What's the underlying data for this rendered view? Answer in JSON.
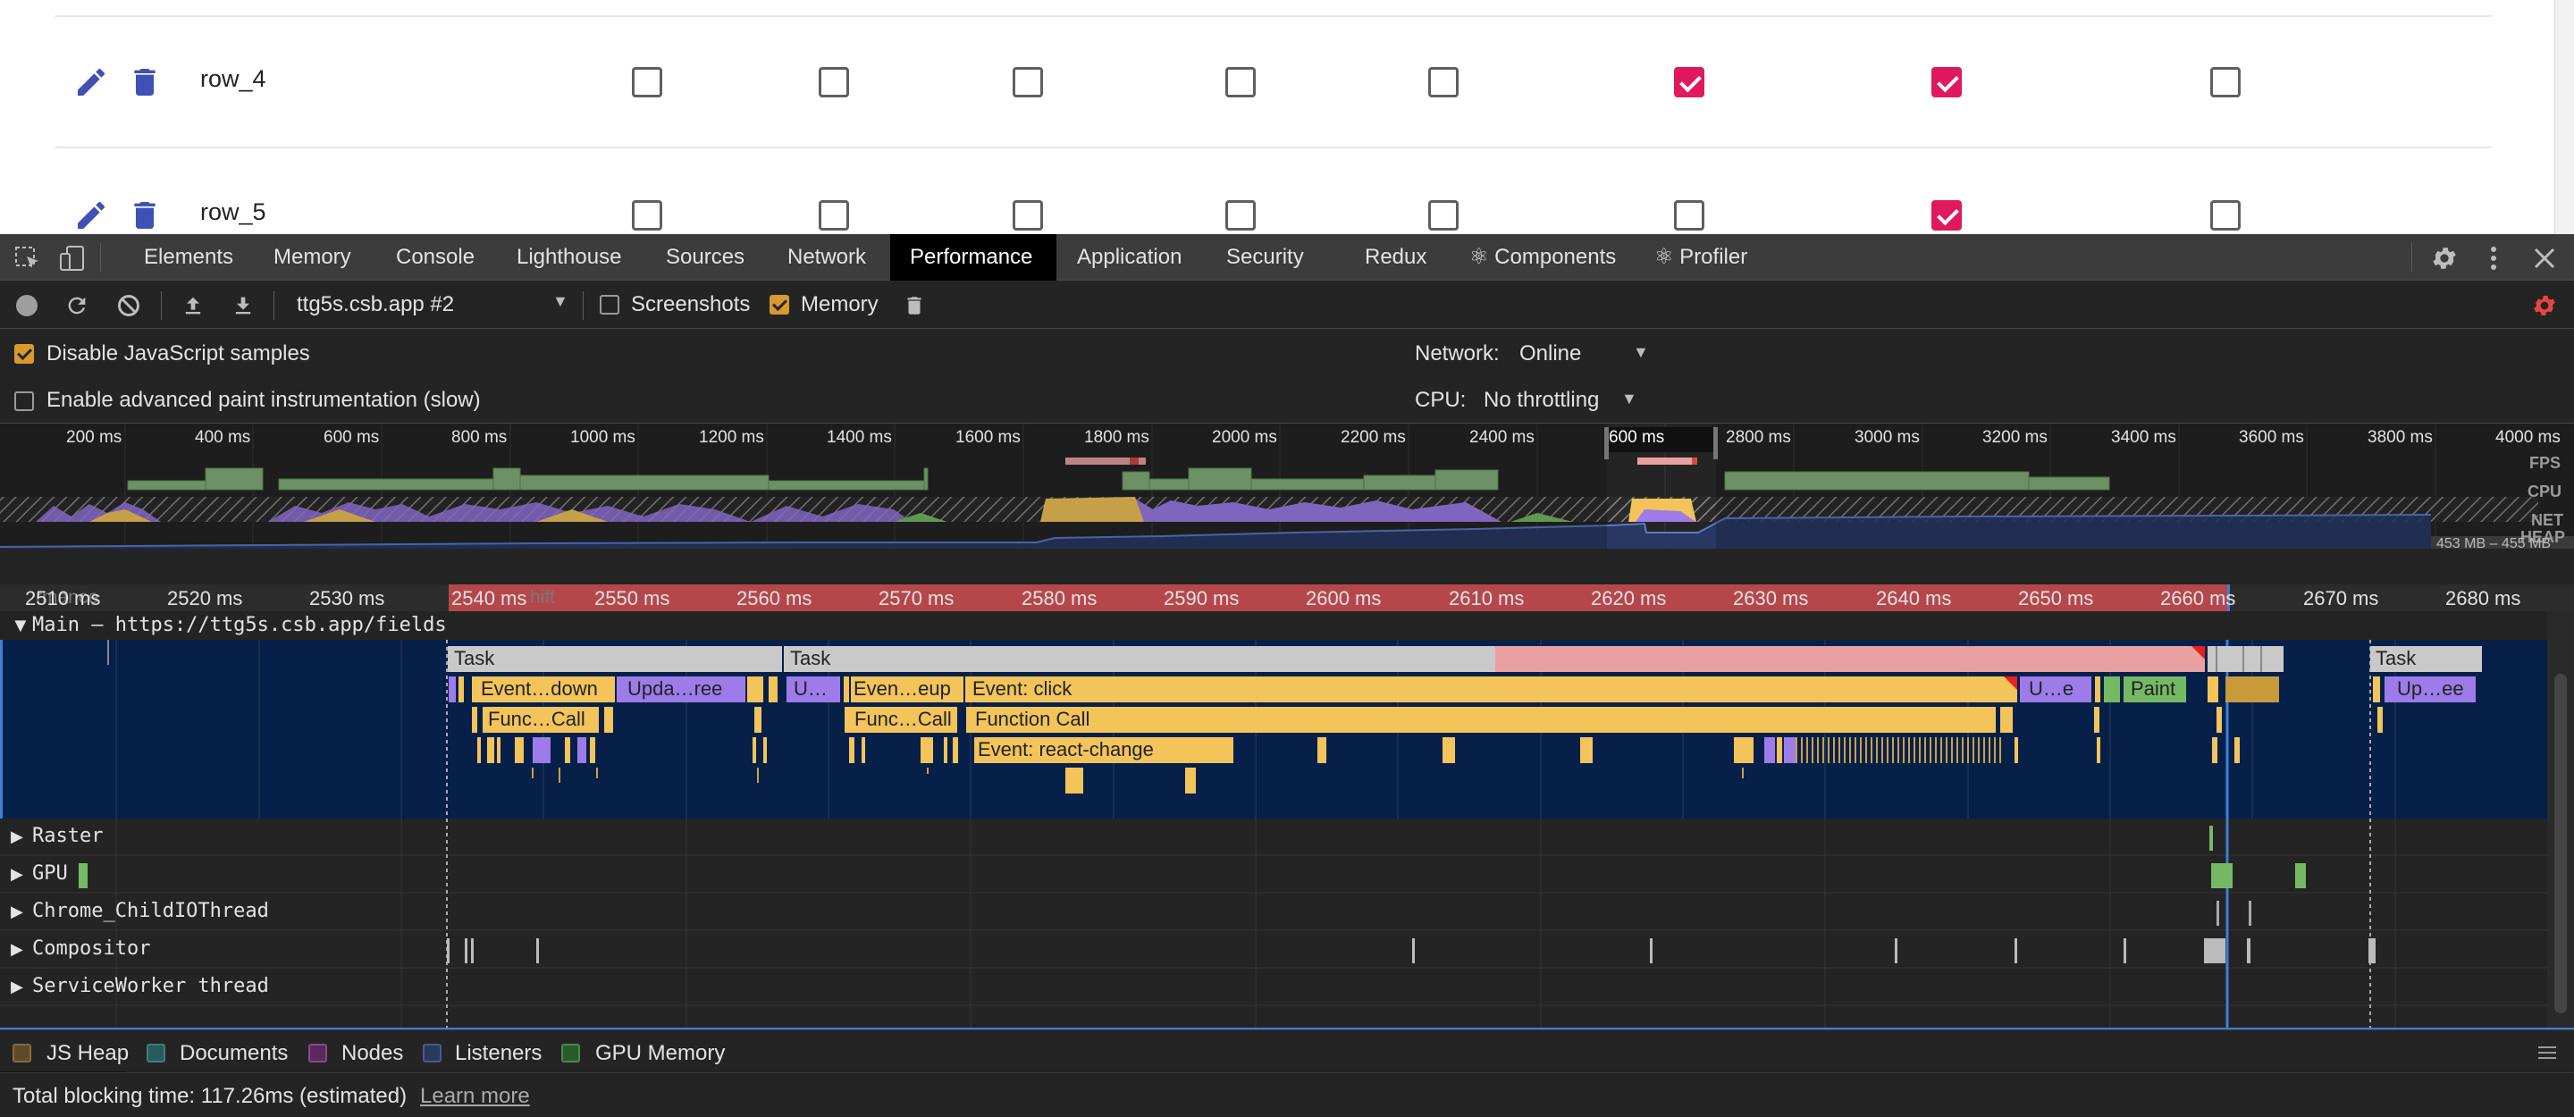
{
  "app": {
    "rows": [
      {
        "label": "row_4",
        "checks": [
          false,
          false,
          false,
          false,
          false,
          true,
          true,
          false
        ]
      },
      {
        "label": "row_5",
        "checks": [
          false,
          false,
          false,
          false,
          false,
          false,
          true,
          false
        ]
      }
    ]
  },
  "devtools": {
    "tabs": [
      "Elements",
      "Memory",
      "Console",
      "Lighthouse",
      "Sources",
      "Network",
      "Performance",
      "Application",
      "Security",
      "Redux",
      "⚛ Components",
      "⚛ Profiler"
    ],
    "active_tab": "Performance",
    "toolbar": {
      "profile_select": "ttg5s.csb.app #2",
      "screenshots_label": "Screenshots",
      "screenshots_checked": false,
      "memory_label": "Memory",
      "memory_checked": true
    },
    "settings": {
      "disable_js_samples": "Disable JavaScript samples",
      "disable_js_samples_checked": true,
      "advanced_paint": "Enable advanced paint instrumentation (slow)",
      "advanced_paint_checked": false,
      "network_label": "Network:",
      "network_value": "Online",
      "cpu_label": "CPU:",
      "cpu_value": "No throttling"
    },
    "overview": {
      "ticks": [
        "200 ms",
        "400 ms",
        "600 ms",
        "800 ms",
        "1000 ms",
        "1200 ms",
        "1400 ms",
        "1600 ms",
        "1800 ms",
        "2000 ms",
        "2200 ms",
        "2400 ms",
        "600 ms",
        "2800 ms",
        "3000 ms",
        "3200 ms",
        "3400 ms",
        "3600 ms",
        "3800 ms",
        "4000 ms"
      ],
      "labels": {
        "fps": "FPS",
        "cpu": "CPU",
        "net": "NET",
        "heap": "HEAP"
      },
      "heap_range": "453 MB – 455 MB"
    },
    "timeline": {
      "ticks": [
        "2510 ms",
        "2520 ms",
        "2530 ms",
        "2540 ms",
        "2550 ms",
        "2560 ms",
        "2570 ms",
        "2580 ms",
        "2590 ms",
        "2600 ms",
        "2610 ms",
        "2620 ms",
        "2630 ms",
        "2640 ms",
        "2650 ms",
        "2660 ms",
        "2670 ms",
        "2680 ms"
      ],
      "behind_text_1": "rmance",
      "behind_text_2": "hift"
    },
    "tracks": {
      "main": "Main — https://ttg5s.csb.app/fields",
      "raster": "Raster",
      "gpu": "GPU",
      "childio": "Chrome_ChildIOThread",
      "compositor": "Compositor",
      "serviceworker": "ServiceWorker thread"
    },
    "flame": {
      "task": "Task",
      "event_down": "Event…down",
      "upda_ree": "Upda…ree",
      "u1": "U…",
      "even_eup": "Even…eup",
      "event_click": "Event: click",
      "u_e": "U…e",
      "paint": "Paint",
      "up_ee": "Up…ee",
      "func_call": "Func…Call",
      "function_call": "Function Call",
      "react_change": "Event: react-change"
    },
    "legend": [
      "JS Heap",
      "Documents",
      "Nodes",
      "Listeners",
      "GPU Memory"
    ],
    "legend_checked": [
      false,
      false,
      false,
      false,
      false
    ],
    "summary": {
      "text": "Total blocking time: 117.26ms (estimated)",
      "link": "Learn more"
    },
    "colors": {
      "task_yellow": "#f2c45a",
      "purple": "#9d7cea",
      "green": "#76b965",
      "main_bg": "#07204a",
      "ruler_red": "#b5474a"
    }
  }
}
